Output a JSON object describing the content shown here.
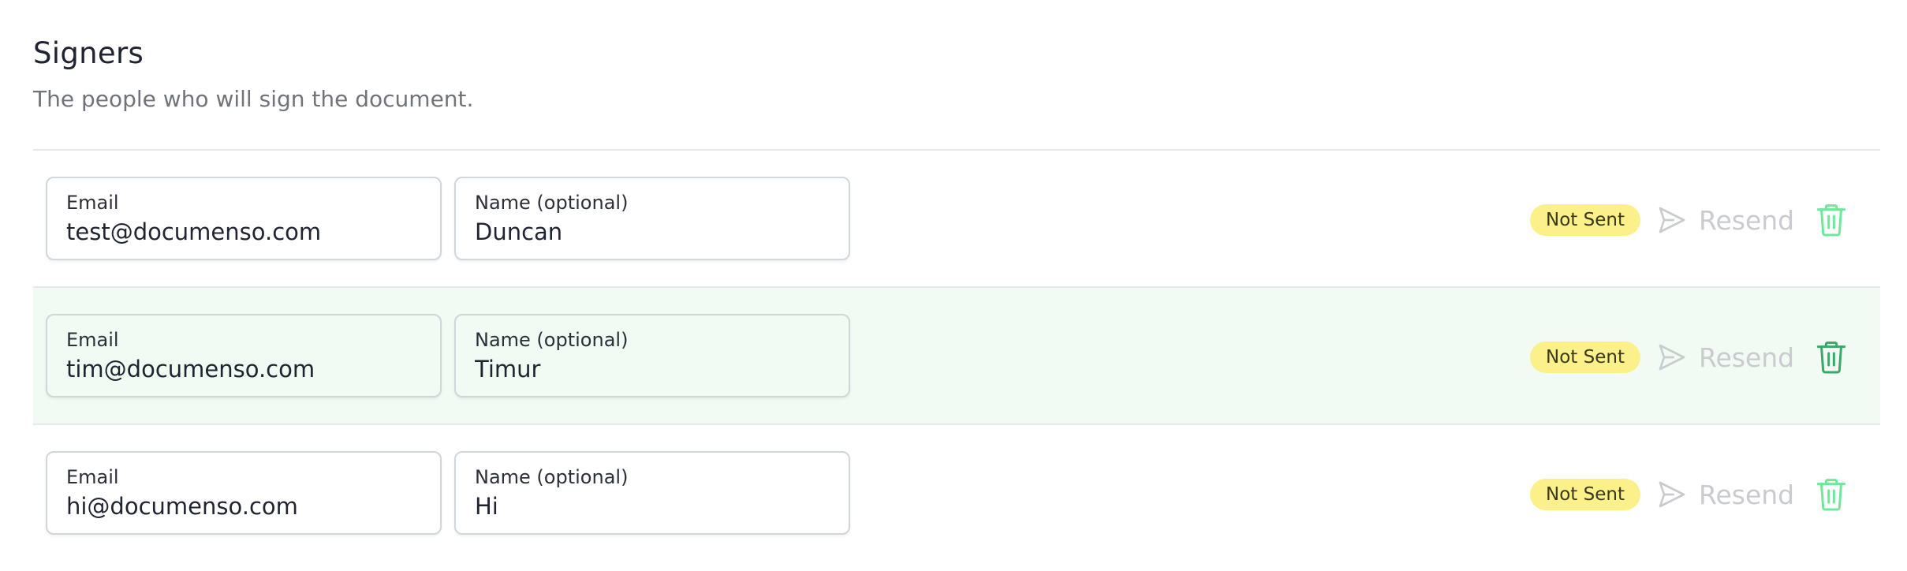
{
  "header": {
    "title": "Signers",
    "subtitle": "The people who will sign the document."
  },
  "colors": {
    "status_badge_bg": "#fbf08a",
    "trash_icon": "#6ee99a",
    "trash_icon_hover": "#3aa868",
    "highlight_row_bg": "#f1fbf3",
    "resend_disabled": "#c9cbcf"
  },
  "signers": [
    {
      "email_label": "Email",
      "email_value": "test@documenso.com",
      "name_label": "Name (optional)",
      "name_value": "Duncan",
      "status": "Not Sent",
      "resend_label": "Resend"
    },
    {
      "email_label": "Email",
      "email_value": "tim@documenso.com",
      "name_label": "Name (optional)",
      "name_value": "Timur",
      "status": "Not Sent",
      "resend_label": "Resend"
    },
    {
      "email_label": "Email",
      "email_value": "hi@documenso.com",
      "name_label": "Name (optional)",
      "name_value": "Hi",
      "status": "Not Sent",
      "resend_label": "Resend"
    }
  ]
}
